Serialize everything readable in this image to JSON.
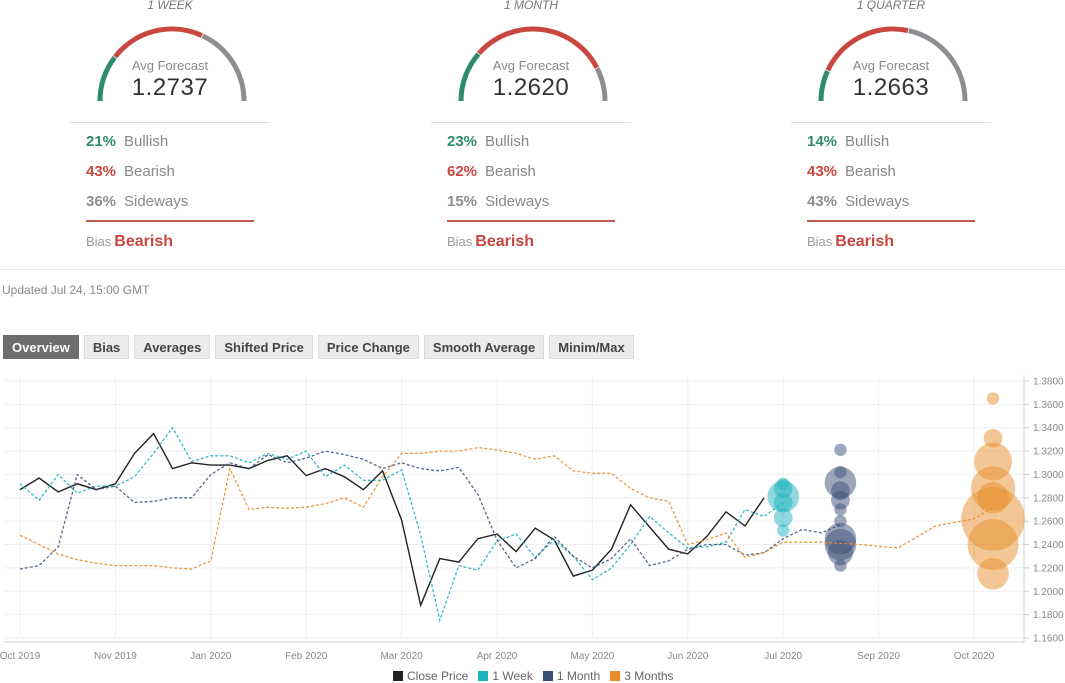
{
  "gauges": [
    {
      "title": "1 WEEK",
      "label": "Avg Forecast",
      "value": "1.2737",
      "bullish_pct": "21%",
      "bullish_label": "Bullish",
      "bearish_pct": "43%",
      "bearish_label": "Bearish",
      "sideways_pct": "36%",
      "sideways_label": "Sideways",
      "bias_word": "Bias",
      "bias_value": "Bearish",
      "shares": [
        21,
        43,
        36
      ]
    },
    {
      "title": "1 MONTH",
      "label": "Avg Forecast",
      "value": "1.2620",
      "bullish_pct": "23%",
      "bullish_label": "Bullish",
      "bearish_pct": "62%",
      "bearish_label": "Bearish",
      "sideways_pct": "15%",
      "sideways_label": "Sideways",
      "bias_word": "Bias",
      "bias_value": "Bearish",
      "shares": [
        23,
        62,
        15
      ]
    },
    {
      "title": "1 QUARTER",
      "label": "Avg Forecast",
      "value": "1.2663",
      "bullish_pct": "14%",
      "bullish_label": "Bullish",
      "bearish_pct": "43%",
      "bearish_label": "Bearish",
      "sideways_pct": "43%",
      "sideways_label": "Sideways",
      "bias_word": "Bias",
      "bias_value": "Bearish",
      "shares": [
        14,
        43,
        43
      ]
    }
  ],
  "colors": {
    "bullish": "#2e8b6e",
    "bearish": "#c8473e",
    "sideways": "#8e8e92",
    "close": "#222222",
    "week": "#21b3bd",
    "month": "#3b5078",
    "quarter": "#e88f2c"
  },
  "updated": "Updated Jul 24, 15:00 GMT",
  "tabs": [
    {
      "label": "Overview",
      "active": true
    },
    {
      "label": "Bias",
      "active": false
    },
    {
      "label": "Averages",
      "active": false
    },
    {
      "label": "Shifted Price",
      "active": false
    },
    {
      "label": "Price Change",
      "active": false
    },
    {
      "label": "Smooth Average",
      "active": false
    },
    {
      "label": "Minim/Max",
      "active": false
    }
  ],
  "chart_data": {
    "type": "line",
    "title": "",
    "xlabel": "",
    "ylabel": "",
    "x_tick_labels": [
      "Oct 2019",
      "Nov 2019",
      "Jan 2020",
      "Feb 2020",
      "Mar 2020",
      "Apr 2020",
      "May 2020",
      "Jun 2020",
      "Jul 2020",
      "Sep 2020",
      "Oct 2020"
    ],
    "y_tick_labels": [
      "1.3800",
      "1.3600",
      "1.3400",
      "1.3200",
      "1.3000",
      "1.2800",
      "1.2600",
      "1.2400",
      "1.2200",
      "1.2000",
      "1.1800",
      "1.1600"
    ],
    "ylim": [
      1.16,
      1.38
    ],
    "grid": true,
    "legend_position": "bottom-center",
    "legend": [
      "Close Price",
      "1 Week",
      "1 Month",
      "3 Months"
    ],
    "series": [
      {
        "name": "Close Price",
        "style": "solid",
        "x": [
          0,
          0.2,
          0.4,
          0.6,
          0.8,
          1.0,
          1.2,
          1.4,
          1.6,
          1.8,
          2.0,
          2.2,
          2.4,
          2.6,
          2.8,
          3.0,
          3.2,
          3.4,
          3.6,
          3.8,
          4.0,
          4.2,
          4.4,
          4.6,
          4.8,
          5.0,
          5.2,
          5.4,
          5.6,
          5.8,
          6.0,
          6.2,
          6.4,
          6.6,
          6.8,
          7.0,
          7.2,
          7.4,
          7.6,
          7.8
        ],
        "y": [
          1.287,
          1.297,
          1.285,
          1.292,
          1.287,
          1.292,
          1.318,
          1.335,
          1.305,
          1.31,
          1.308,
          1.308,
          1.305,
          1.312,
          1.316,
          1.299,
          1.305,
          1.298,
          1.287,
          1.303,
          1.261,
          1.188,
          1.228,
          1.225,
          1.245,
          1.249,
          1.234,
          1.254,
          1.244,
          1.213,
          1.218,
          1.236,
          1.274,
          1.255,
          1.236,
          1.232,
          1.247,
          1.268,
          1.256,
          1.28
        ]
      },
      {
        "name": "1 Week",
        "style": "dashed",
        "x": [
          0,
          0.2,
          0.4,
          0.6,
          0.8,
          1.0,
          1.2,
          1.4,
          1.6,
          1.8,
          2.0,
          2.2,
          2.4,
          2.6,
          2.8,
          3.0,
          3.2,
          3.4,
          3.6,
          3.8,
          4.0,
          4.2,
          4.4,
          4.6,
          4.8,
          5.0,
          5.2,
          5.4,
          5.6,
          5.8,
          6.0,
          6.2,
          6.4,
          6.6,
          6.8,
          7.0,
          7.2,
          7.4,
          7.6,
          7.8,
          8.0
        ],
        "y": [
          1.292,
          1.278,
          1.3,
          1.284,
          1.29,
          1.29,
          1.298,
          1.318,
          1.34,
          1.311,
          1.316,
          1.316,
          1.31,
          1.318,
          1.313,
          1.32,
          1.298,
          1.308,
          1.295,
          1.295,
          1.304,
          1.248,
          1.175,
          1.222,
          1.218,
          1.243,
          1.249,
          1.229,
          1.244,
          1.23,
          1.21,
          1.22,
          1.24,
          1.264,
          1.25,
          1.237,
          1.238,
          1.242,
          1.27,
          1.264,
          1.276
        ]
      },
      {
        "name": "1 Month",
        "style": "dashed",
        "x": [
          0,
          0.2,
          0.4,
          0.6,
          0.8,
          1.0,
          1.2,
          1.4,
          1.6,
          1.8,
          2.0,
          2.2,
          2.4,
          2.6,
          2.8,
          3.0,
          3.2,
          3.4,
          3.6,
          3.8,
          4.0,
          4.2,
          4.4,
          4.6,
          4.8,
          5.0,
          5.2,
          5.4,
          5.6,
          5.8,
          6.0,
          6.2,
          6.4,
          6.6,
          6.8,
          7.0,
          7.2,
          7.4,
          7.6,
          7.8,
          8.0,
          8.2,
          8.4,
          8.6
        ],
        "y": [
          1.219,
          1.222,
          1.238,
          1.3,
          1.287,
          1.29,
          1.276,
          1.277,
          1.28,
          1.28,
          1.3,
          1.31,
          1.305,
          1.317,
          1.31,
          1.314,
          1.32,
          1.317,
          1.313,
          1.305,
          1.31,
          1.305,
          1.303,
          1.306,
          1.283,
          1.244,
          1.22,
          1.228,
          1.247,
          1.23,
          1.22,
          1.228,
          1.245,
          1.222,
          1.226,
          1.236,
          1.24,
          1.24,
          1.231,
          1.233,
          1.245,
          1.253,
          1.25,
          1.257
        ]
      },
      {
        "name": "3 Months",
        "style": "dashed",
        "x": [
          0,
          0.2,
          0.4,
          0.6,
          0.8,
          1.0,
          1.2,
          1.4,
          1.6,
          1.8,
          2.0,
          2.2,
          2.4,
          2.6,
          2.8,
          3.0,
          3.2,
          3.4,
          3.6,
          3.8,
          4.0,
          4.2,
          4.4,
          4.6,
          4.8,
          5.0,
          5.2,
          5.4,
          5.6,
          5.8,
          6.0,
          6.2,
          6.4,
          6.6,
          6.8,
          7.0,
          7.2,
          7.4,
          7.6,
          7.8,
          8.0,
          8.4,
          8.8,
          9.2,
          9.6,
          10.0,
          10.2
        ],
        "y": [
          1.248,
          1.24,
          1.232,
          1.227,
          1.224,
          1.222,
          1.222,
          1.222,
          1.22,
          1.219,
          1.226,
          1.305,
          1.27,
          1.272,
          1.271,
          1.272,
          1.275,
          1.28,
          1.272,
          1.298,
          1.318,
          1.318,
          1.32,
          1.32,
          1.323,
          1.321,
          1.318,
          1.313,
          1.316,
          1.303,
          1.301,
          1.301,
          1.288,
          1.28,
          1.277,
          1.24,
          1.244,
          1.25,
          1.229,
          1.233,
          1.242,
          1.242,
          1.24,
          1.237,
          1.256,
          1.262,
          1.272
        ]
      }
    ],
    "forecast_bubbles": [
      {
        "name": "1 Week",
        "x": 8.0,
        "points": [
          {
            "y": 1.292,
            "size": 1
          },
          {
            "y": 1.288,
            "size": 2
          },
          {
            "y": 1.281,
            "size": 4
          },
          {
            "y": 1.276,
            "size": 2
          },
          {
            "y": 1.263,
            "size": 2
          },
          {
            "y": 1.252,
            "size": 1
          }
        ]
      },
      {
        "name": "1 Month",
        "x": 8.6,
        "points": [
          {
            "y": 1.321,
            "size": 1
          },
          {
            "y": 1.302,
            "size": 1
          },
          {
            "y": 1.293,
            "size": 4
          },
          {
            "y": 1.286,
            "size": 2
          },
          {
            "y": 1.278,
            "size": 2
          },
          {
            "y": 1.27,
            "size": 1
          },
          {
            "y": 1.26,
            "size": 1
          },
          {
            "y": 1.245,
            "size": 4
          },
          {
            "y": 1.24,
            "size": 4
          },
          {
            "y": 1.233,
            "size": 3
          },
          {
            "y": 1.222,
            "size": 1
          }
        ]
      },
      {
        "name": "3 Months",
        "x": 10.2,
        "points": [
          {
            "y": 1.365,
            "size": 1
          },
          {
            "y": 1.331,
            "size": 2
          },
          {
            "y": 1.311,
            "size": 5
          },
          {
            "y": 1.288,
            "size": 6
          },
          {
            "y": 1.28,
            "size": 4
          },
          {
            "y": 1.262,
            "size": 9
          },
          {
            "y": 1.24,
            "size": 7
          },
          {
            "y": 1.215,
            "size": 4
          }
        ]
      }
    ]
  }
}
